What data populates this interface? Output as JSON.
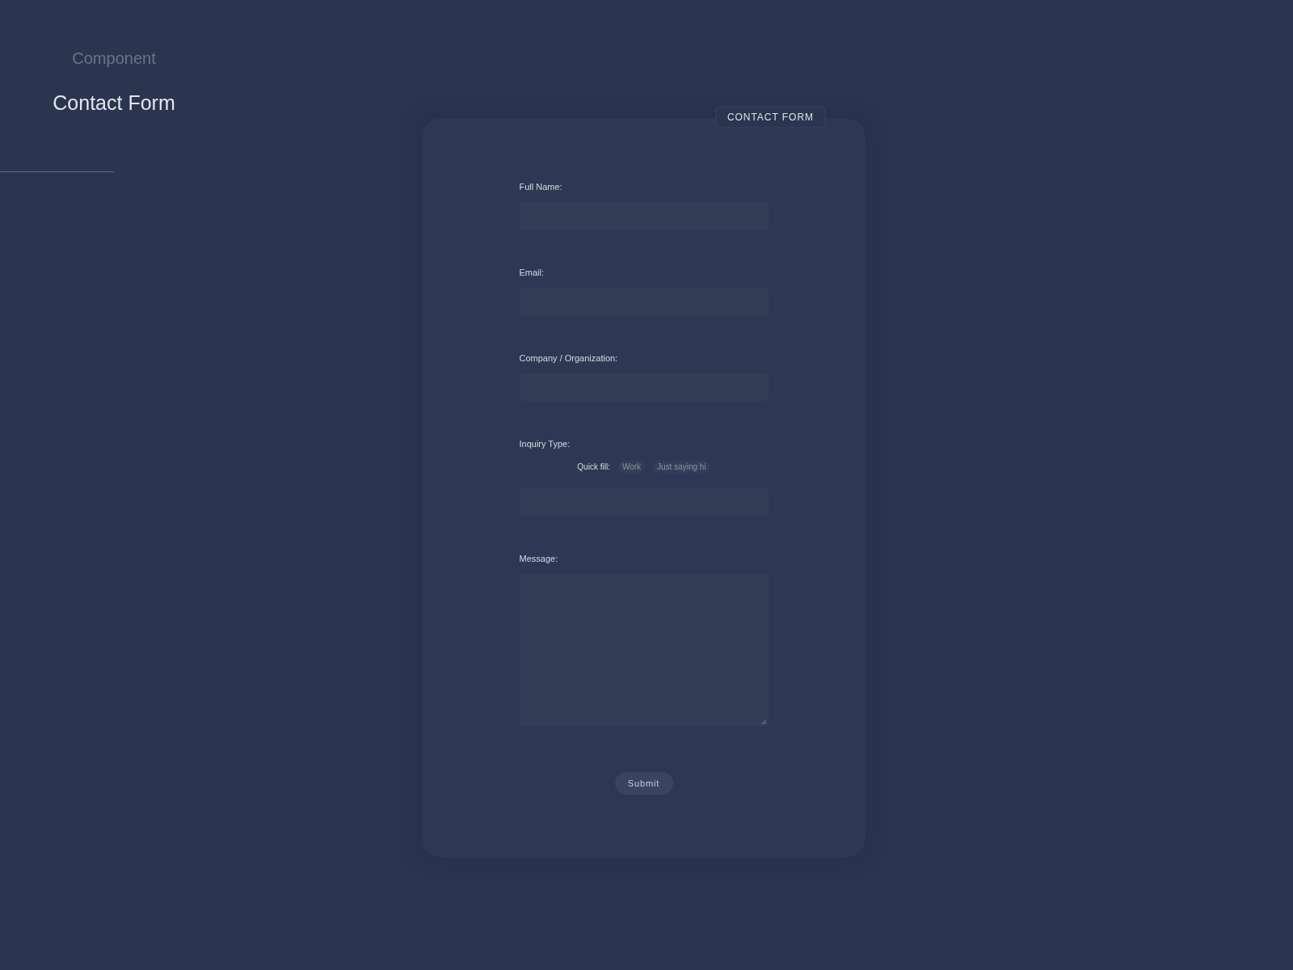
{
  "header": {
    "eyebrow": "Component",
    "title": "Contact Form"
  },
  "form": {
    "tag": "CONTACT FORM",
    "fields": [
      {
        "label": "Full Name:",
        "kind": "input"
      },
      {
        "label": "Email:",
        "kind": "input"
      },
      {
        "label": "Company / Organization:",
        "kind": "input"
      },
      {
        "label": "Inquiry Type:",
        "kind": "input",
        "quick_fill": {
          "label": "Quick fill:",
          "options": [
            "Work",
            "Just saying hi"
          ]
        }
      },
      {
        "label": "Message:",
        "kind": "textarea"
      }
    ],
    "submit": "Submit"
  }
}
